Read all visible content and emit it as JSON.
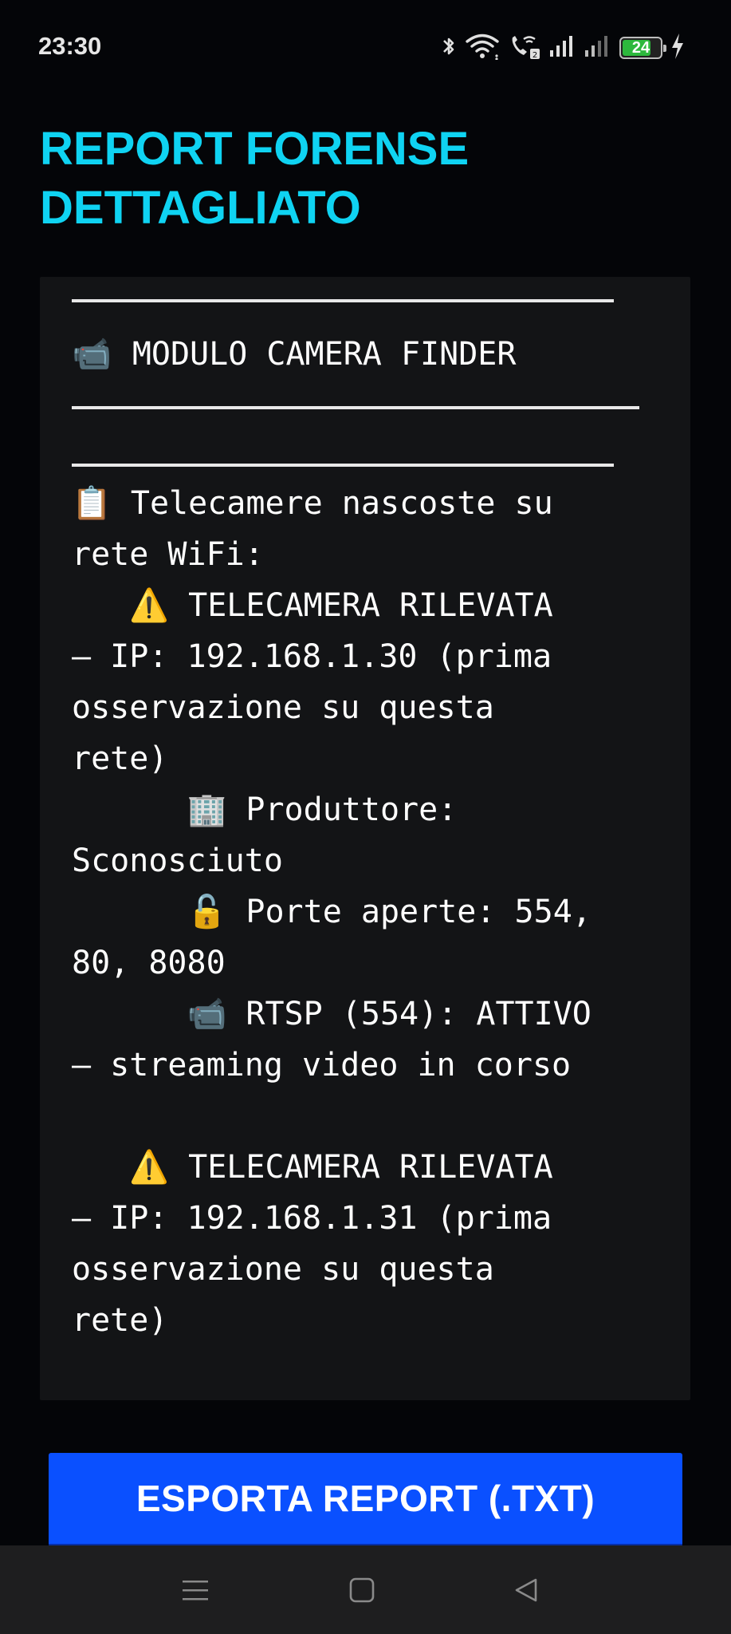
{
  "status_bar": {
    "time": "23:30",
    "battery_level": "24",
    "battery_percent": 24,
    "icons": [
      "bluetooth-icon",
      "wifi-icon",
      "wifi-call-icon",
      "signal-icon",
      "signal-icon",
      "battery-icon",
      "charging-icon"
    ]
  },
  "title": "REPORT FORENSE\nDETTAGLIATO",
  "report": {
    "module_icon": "📹",
    "module_title": "MODULO CAMERA FINDER",
    "body_text": "📋 Telecamere nascoste su\nrete WiFi:\n   ⚠️ TELECAMERA RILEVATA\n— IP: 192.168.1.30 (prima\nosservazione su questa\nrete)\n      🏢 Produttore:\nSconosciuto\n      🔓 Porte aperte: 554,\n80, 8080\n      📹 RTSP (554): ATTIVO\n— streaming video in corso\n\n   ⚠️ TELECAMERA RILEVATA\n— IP: 192.168.1.31 (prima\nosservazione su questa\nrete)"
  },
  "export_button": {
    "label": "ESPORTA REPORT (.TXT)"
  },
  "nav": {
    "icons": [
      "menu-icon",
      "home-icon",
      "back-icon"
    ]
  },
  "colors": {
    "title": "#0fd3f2",
    "button": "#0a50ff",
    "panel": "#131416",
    "background": "#040508"
  }
}
